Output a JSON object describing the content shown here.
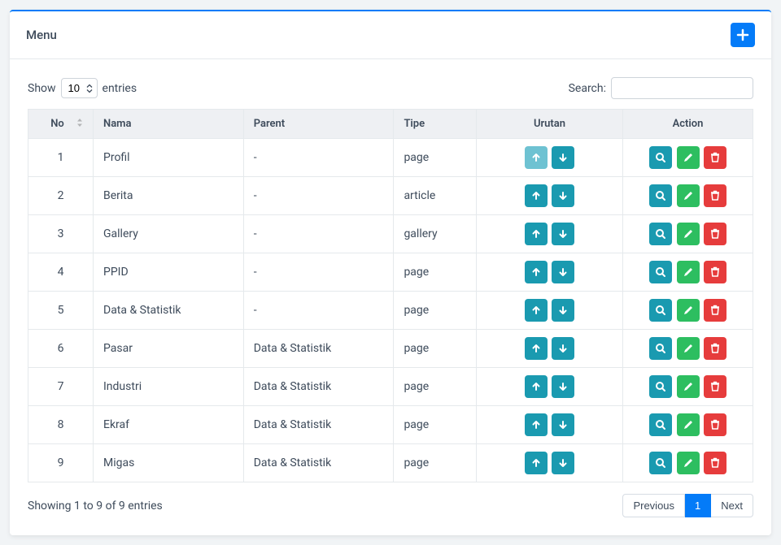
{
  "card": {
    "title": "Menu",
    "add_symbol": "+"
  },
  "length_menu": {
    "show_label": "Show",
    "entries_label": "entries",
    "selected": "10"
  },
  "search": {
    "label": "Search:",
    "value": ""
  },
  "columns": {
    "no": "No",
    "nama": "Nama",
    "parent": "Parent",
    "tipe": "Tipe",
    "urutan": "Urutan",
    "action": "Action"
  },
  "rows": [
    {
      "no": "1",
      "nama": "Profil",
      "parent": "-",
      "tipe": "page",
      "up_disabled": true
    },
    {
      "no": "2",
      "nama": "Berita",
      "parent": "-",
      "tipe": "article",
      "up_disabled": false
    },
    {
      "no": "3",
      "nama": "Gallery",
      "parent": "-",
      "tipe": "gallery",
      "up_disabled": false
    },
    {
      "no": "4",
      "nama": "PPID",
      "parent": "-",
      "tipe": "page",
      "up_disabled": false
    },
    {
      "no": "5",
      "nama": "Data & Statistik",
      "parent": "-",
      "tipe": "page",
      "up_disabled": false
    },
    {
      "no": "6",
      "nama": "Pasar",
      "parent": "Data & Statistik",
      "tipe": "page",
      "up_disabled": false
    },
    {
      "no": "7",
      "nama": "Industri",
      "parent": "Data & Statistik",
      "tipe": "page",
      "up_disabled": false
    },
    {
      "no": "8",
      "nama": "Ekraf",
      "parent": "Data & Statistik",
      "tipe": "page",
      "up_disabled": false
    },
    {
      "no": "9",
      "nama": "Migas",
      "parent": "Data & Statistik",
      "tipe": "page",
      "up_disabled": false
    }
  ],
  "footer": {
    "info": "Showing 1 to 9 of 9 entries",
    "prev": "Previous",
    "page": "1",
    "next": "Next"
  }
}
